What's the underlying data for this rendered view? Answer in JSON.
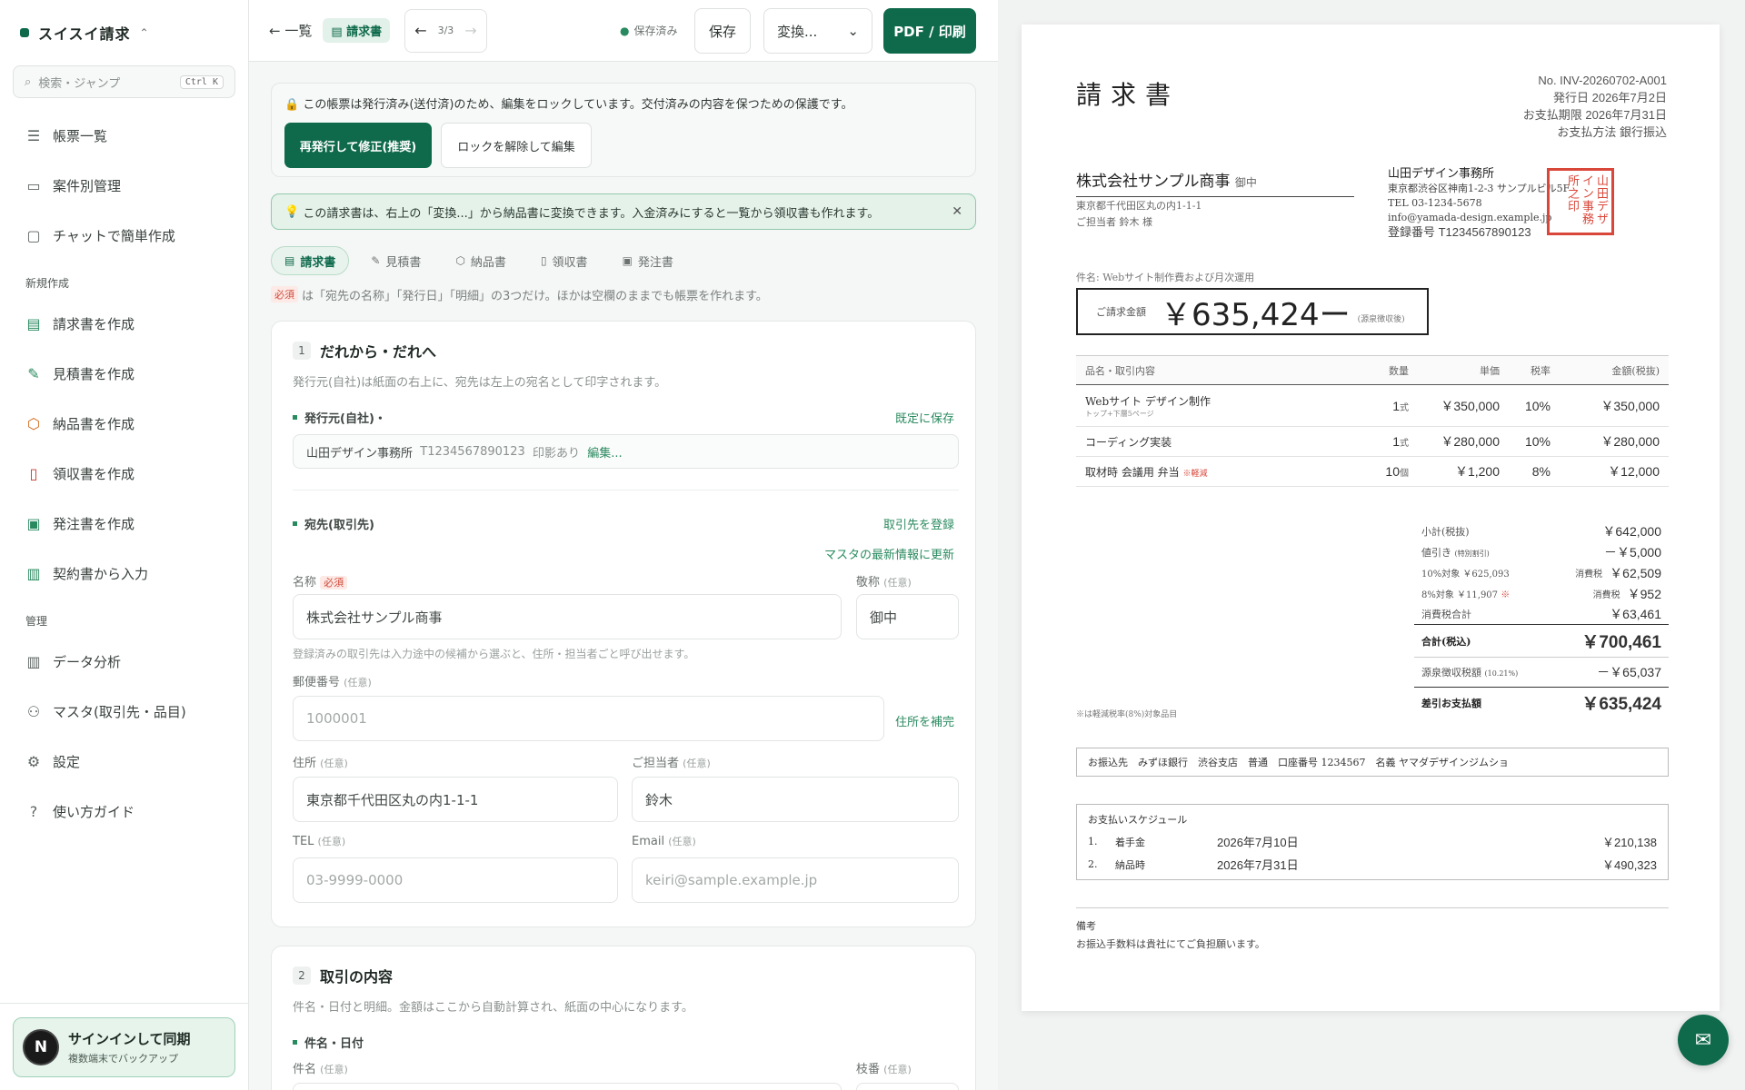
{
  "sidebar": {
    "brand": "スイスイ請求",
    "search": {
      "placeholder": "検索・ジャンプ",
      "shortcut": "Ctrl K"
    },
    "items": [
      {
        "label": "帳票一覧",
        "icon": "list-icon"
      },
      {
        "label": "案件別管理",
        "icon": "folder-icon"
      },
      {
        "label": "チャットで簡単作成",
        "icon": "chat-icon"
      }
    ],
    "new_section": "新規作成",
    "new_items": [
      {
        "label": "請求書を作成",
        "icon": "invoice-icon"
      },
      {
        "label": "見積書を作成",
        "icon": "quote-icon"
      },
      {
        "label": "納品書を作成",
        "icon": "box-icon"
      },
      {
        "label": "領収書を作成",
        "icon": "receipt-icon"
      },
      {
        "label": "発注書を作成",
        "icon": "order-icon"
      },
      {
        "label": "契約書から入力",
        "icon": "contract-icon"
      }
    ],
    "admin_section": "管理",
    "admin_items": [
      {
        "label": "データ分析",
        "icon": "chart-icon"
      },
      {
        "label": "マスタ(取引先・品目)",
        "icon": "users-icon"
      },
      {
        "label": "設定",
        "icon": "gear-icon"
      },
      {
        "label": "使い方ガイド",
        "icon": "help-icon"
      }
    ],
    "signin": {
      "avatar": "N",
      "title": "サインインして同期",
      "subtitle": "複数端末でバックアップ"
    }
  },
  "toolbar": {
    "back": "一覧",
    "doc_type": "請求書",
    "pager": "3/3",
    "saved": "保存済み",
    "save": "保存",
    "convert": "変換...",
    "pdf": "PDF / 印刷"
  },
  "lock": {
    "message": "この帳票は発行済み(送付済)のため、編集をロックしています。交付済みの内容を保つための保護です。",
    "reissue": "再発行して修正(推奨)",
    "unlock": "ロックを解除して編集"
  },
  "tip": "この請求書は、右上の「変換...」から納品書に変換できます。入金済みにすると一覧から領収書も作れます。",
  "doc_tabs": [
    "請求書",
    "見積書",
    "納品書",
    "領収書",
    "発注書"
  ],
  "required_note": {
    "badge": "必須",
    "text": "は「宛先の名称」「発行日」「明細」の3つだけ。ほかは空欄のままでも帳票を作れます。"
  },
  "section1": {
    "num": "1",
    "title": "だれから・だれへ",
    "desc": "発行元(自社)は紙面の右上に、宛先は左上の宛名として印字されます。",
    "issuer_label": "発行元(自社)・",
    "save_default": "既定に保存",
    "issuer_summary": {
      "name": "山田デザイン事務所",
      "reg": "T1234567890123",
      "seal": "印影あり",
      "edit": "編集..."
    },
    "recipient_label": "宛先(取引先)",
    "register": "取引先を登録",
    "refresh": "マスタの最新情報に更新",
    "name_label": "名称",
    "name_req": "必須",
    "name_value": "株式会社サンプル商事",
    "honorific_label": "敬称",
    "optional": "(任意)",
    "honorific_value": "御中",
    "name_hint": "登録済みの取引先は入力途中の候補から選ぶと、住所・担当者ごと呼び出せます。",
    "zip_label": "郵便番号",
    "zip_placeholder": "1000001",
    "fill_address": "住所を補完",
    "address_label": "住所",
    "address_value": "東京都千代田区丸の内1-1-1",
    "contact_label": "ご担当者",
    "contact_value": "鈴木",
    "tel_label": "TEL",
    "tel_placeholder": "03-9999-0000",
    "email_label": "Email",
    "email_placeholder": "keiri@sample.example.jp"
  },
  "section2": {
    "num": "2",
    "title": "取引の内容",
    "desc": "件名・日付と明細。金額はここから自動計算され、紙面の中心になります。",
    "sub": "件名・日付",
    "subject_label": "件名",
    "optional": "(任意)",
    "branch_label": "枝番"
  },
  "invoice": {
    "title": "請求書",
    "no": "No. INV-20260702-A001",
    "issued": "発行日 2026年7月2日",
    "due": "お支払期限 2026年7月31日",
    "method": "お支払方法 銀行振込",
    "client": "株式会社サンプル商事",
    "client_hon": "御中",
    "client_addr": "東京都千代田区丸の内1-1-1",
    "client_contact": "ご担当者 鈴木 様",
    "issuer_name": "山田デザイン事務所",
    "issuer_addr": "東京都渋谷区神南1-2-3 サンプルビル5F",
    "issuer_tel": "TEL 03-1234-5678",
    "issuer_mail": "info@yamada-design.example.jp",
    "issuer_reg": "登録番号 T1234567890123",
    "stamp": "山田デザイン事務所之印",
    "subject": "件名: Webサイト制作費および月次運用",
    "total_label": "ご請求金額",
    "total": "￥635,424ー",
    "total_note": "(源泉徴収後)",
    "headers": [
      "品名・取引内容",
      "数量",
      "単価",
      "税率",
      "金額(税抜)"
    ],
    "items": [
      {
        "name": "Webサイト デザイン制作",
        "sub": "トップ+下層5ページ",
        "qty": "1",
        "unit": "式",
        "price": "￥350,000",
        "rate": "10%",
        "amount": "￥350,000"
      },
      {
        "name": "コーディング実装",
        "sub": "",
        "qty": "1",
        "unit": "式",
        "price": "￥280,000",
        "rate": "10%",
        "amount": "￥280,000"
      },
      {
        "name": "取材時 会議用 弁当",
        "sub": "",
        "mark": "※軽減",
        "qty": "10",
        "unit": "個",
        "price": "￥1,200",
        "rate": "8%",
        "amount": "￥12,000"
      }
    ],
    "subtotal_l": "小計(税抜)",
    "subtotal": "￥642,000",
    "discount_l": "値引き",
    "discount_note": "(特別割引)",
    "discount": "－￥5,000",
    "tax10_l": "10%対象 ￥625,093",
    "tax10_m": "消費税",
    "tax10": "￥62,509",
    "tax8_l": "8%対象 ￥11,907",
    "tax8_mark": "※",
    "tax8_m": "消費税",
    "tax8": "￥952",
    "taxtotal_l": "消費税合計",
    "taxtotal": "￥63,461",
    "grand_l": "合計(税込)",
    "grand": "￥700,461",
    "wh_l": "源泉徴収税額",
    "wh_rate": "(10.21%)",
    "wh": "－￥65,037",
    "net_l": "差引お支払額",
    "net": "￥635,424",
    "note": "※は軽減税率(8%)対象品目",
    "bank": "お振込先　みずほ銀行　渋谷支店　普通　口座番号 1234567　名義 ヤマダデザインジムショ",
    "schedule_title": "お支払いスケジュール",
    "schedule": [
      {
        "no": "1.",
        "label": "着手金",
        "date": "2026年7月10日",
        "amount": "￥210,138"
      },
      {
        "no": "2.",
        "label": "納品時",
        "date": "2026年7月31日",
        "amount": "￥490,323"
      }
    ],
    "memo_title": "備考",
    "memo": "お振込手数料は貴社にてご負担願います。"
  },
  "colors": {
    "accent": "#0e6a4b",
    "stamp": "#d9473a"
  }
}
